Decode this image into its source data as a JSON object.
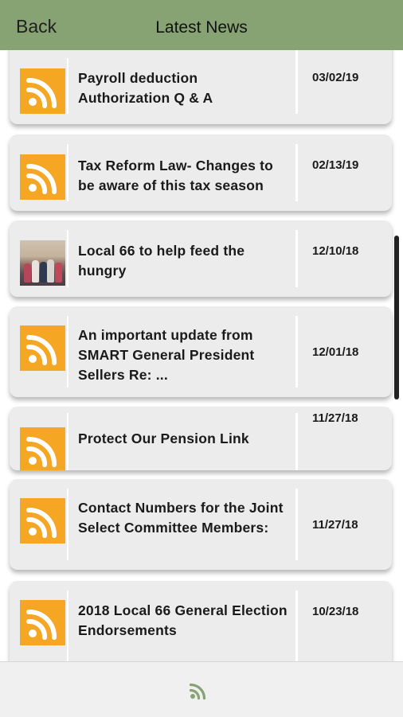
{
  "header": {
    "back_label": "Back",
    "title": "Latest News",
    "background": "#87a374"
  },
  "icons": {
    "rss": "rss-icon",
    "accent": "#f5a623",
    "footer_icon_color": "#87a374"
  },
  "news": [
    {
      "title": "Payroll deduction Authorization Q & A",
      "date": "03/02/19",
      "thumbnail": "rss"
    },
    {
      "title": "Tax Reform Law- Changes to be aware of this tax season",
      "date": "02/13/19",
      "thumbnail": "rss"
    },
    {
      "title": "Local 66 to help feed the hungry",
      "date": "12/10/18",
      "thumbnail": "photo"
    },
    {
      "title": "An important update from SMART General President Sellers Re: ...",
      "date": "12/01/18",
      "thumbnail": "rss"
    },
    {
      "title": "Protect Our Pension Link",
      "date": "11/27/18",
      "thumbnail": "rss"
    },
    {
      "title": "Contact Numbers for the Joint Select Committee Members:",
      "date": "11/27/18",
      "thumbnail": "rss"
    },
    {
      "title": "2018 Local 66 General Election Endorsements",
      "date": "10/23/18",
      "thumbnail": "rss"
    }
  ]
}
